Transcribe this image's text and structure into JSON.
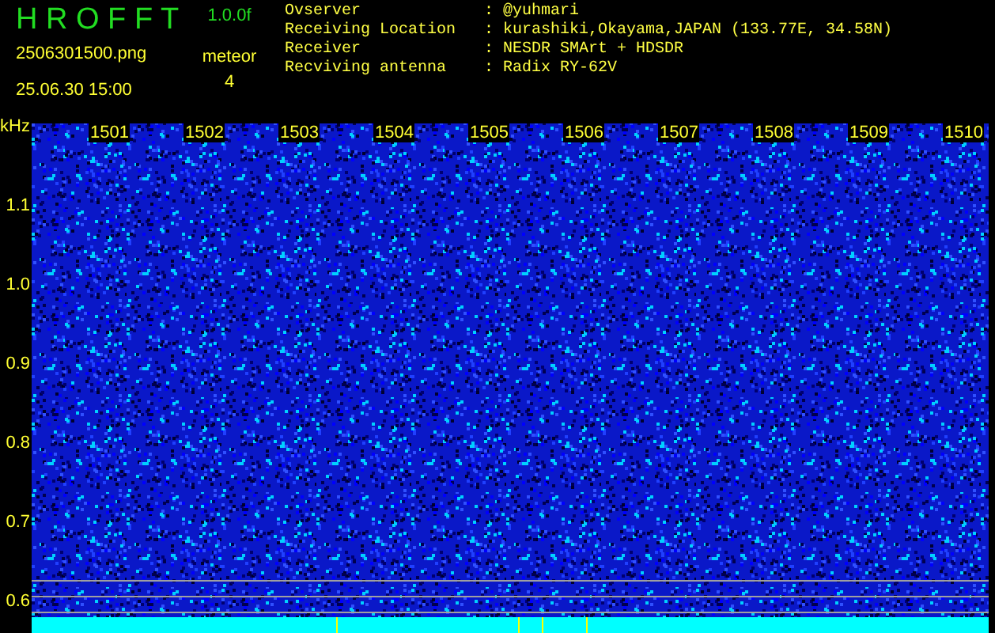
{
  "header": {
    "title": "H R O F F T",
    "version": "1.0.0f",
    "filename": "2506301500.png",
    "datetime": "25.06.30 15:00",
    "counter_label": "meteor",
    "counter_value": "4"
  },
  "info": [
    {
      "label": "Ovserver",
      "separator": ":",
      "value": "@yuhmari"
    },
    {
      "label": "Receiving Location",
      "separator": ":",
      "value": "kurashiki,Okayama,JAPAN (133.77E, 34.58N)"
    },
    {
      "label": "Receiver",
      "separator": ":",
      "value": "NESDR SMArt + HDSDR"
    },
    {
      "label": "Recviving antenna",
      "separator": ":",
      "value": "Radix RY-62V"
    }
  ],
  "spectrogram": {
    "y_unit": "kHz",
    "x_labels": [
      "1501",
      "1502",
      "1503",
      "1504",
      "1505",
      "1506",
      "1507",
      "1508",
      "1509",
      "1510"
    ],
    "y_labels": [
      "1.1",
      "1.0",
      "0.9",
      "0.8",
      "0.7",
      "0.6"
    ]
  }
}
